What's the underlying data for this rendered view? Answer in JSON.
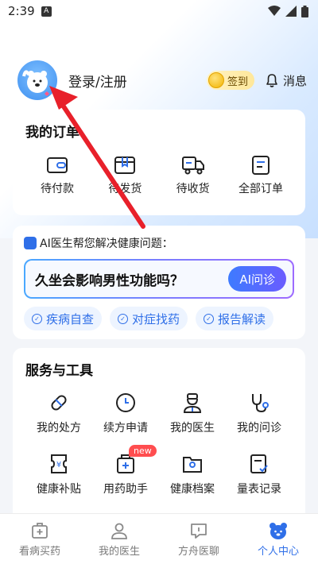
{
  "status_bar": {
    "time": "2:39",
    "badge": "A"
  },
  "header": {
    "login_label": "登录/注册",
    "checkin_label": "签到",
    "message_label": "消息"
  },
  "orders": {
    "title": "我的订单",
    "items": [
      {
        "label": "待付款",
        "icon": "wallet-icon"
      },
      {
        "label": "待发货",
        "icon": "box-icon"
      },
      {
        "label": "待收货",
        "icon": "truck-icon"
      },
      {
        "label": "全部订单",
        "icon": "order-list-icon"
      }
    ]
  },
  "ai": {
    "title": "AI医生帮您解决健康问题：",
    "question": "久坐会影响男性功能吗？",
    "ask_button": "AI问诊",
    "chips": [
      "疾病自查",
      "对症找药",
      "报告解读"
    ]
  },
  "tools": {
    "title": "服务与工具",
    "items": [
      {
        "label": "我的处方",
        "icon": "pill-icon"
      },
      {
        "label": "续方申请",
        "icon": "clock-icon"
      },
      {
        "label": "我的医生",
        "icon": "doctor-icon"
      },
      {
        "label": "我的问诊",
        "icon": "stethoscope-icon"
      },
      {
        "label": "健康补贴",
        "icon": "coupon-icon"
      },
      {
        "label": "用药助手",
        "icon": "medicine-box-icon",
        "badge": "new"
      },
      {
        "label": "健康档案",
        "icon": "profile-folder-icon"
      },
      {
        "label": "量表记录",
        "icon": "checklist-icon"
      }
    ]
  },
  "nav": {
    "items": [
      {
        "label": "看病买药",
        "icon": "medkit-icon"
      },
      {
        "label": "我的医生",
        "icon": "doctor-icon"
      },
      {
        "label": "方舟医聊",
        "icon": "chat-icon"
      },
      {
        "label": "个人中心",
        "icon": "bear-icon"
      }
    ],
    "active": "个人中心"
  },
  "colors": {
    "accent": "#2f6fe8",
    "arrow": "#e8202a"
  }
}
